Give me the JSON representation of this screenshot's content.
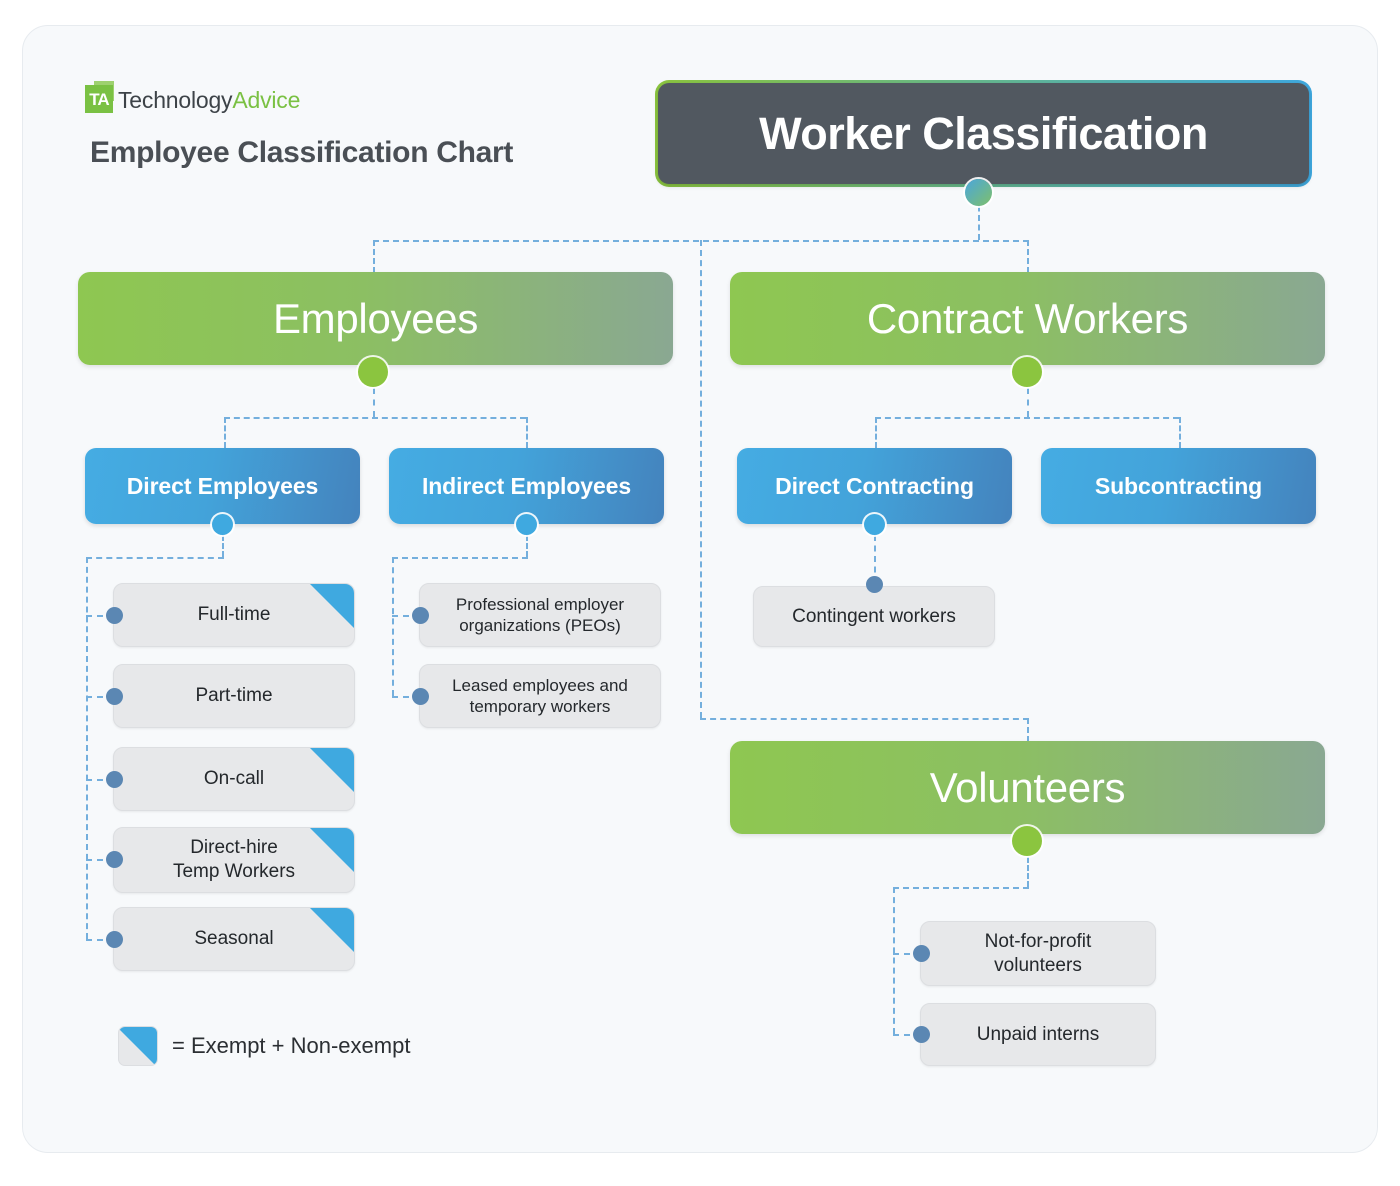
{
  "brand": {
    "logo_mark": "TA",
    "name_part1": "Technology",
    "name_part2": "Advice"
  },
  "page_title": "Employee Classification Chart",
  "legend": {
    "symbol": "blue-corner-triangle",
    "text": "= Exempt + Non-exempt"
  },
  "colors": {
    "green": "#8bc53f",
    "blue": "#3fa9e0",
    "dark": "#515860",
    "leaf_gray": "#e7e8ea",
    "connector": "#74afdd",
    "card_bg": "#f7f9fb"
  },
  "chart_data": {
    "type": "diagram",
    "title": "Worker Classification",
    "root": "Worker Classification",
    "nodes": {
      "root": {
        "label": "Worker Classification",
        "level": 0
      },
      "employees": {
        "label": "Employees",
        "level": 1
      },
      "contract_workers": {
        "label": "Contract Workers",
        "level": 1
      },
      "volunteers": {
        "label": "Volunteers",
        "level": 1
      },
      "direct_employees": {
        "label": "Direct Employees",
        "level": 2
      },
      "indirect_employees": {
        "label": "Indirect Employees",
        "level": 2
      },
      "direct_contracting": {
        "label": "Direct Contracting",
        "level": 2
      },
      "subcontracting": {
        "label": "Subcontracting",
        "level": 2
      }
    },
    "leaves": {
      "direct_employees": [
        {
          "label": "Full-time",
          "exempt_marker": true
        },
        {
          "label": "Part-time",
          "exempt_marker": false
        },
        {
          "label": "On-call",
          "exempt_marker": true
        },
        {
          "label": "Direct-hire\nTemp Workers",
          "exempt_marker": true
        },
        {
          "label": "Seasonal",
          "exempt_marker": true
        }
      ],
      "indirect_employees": [
        {
          "label": "Professional employer\norganizations (PEOs)",
          "exempt_marker": false
        },
        {
          "label": "Leased employees and\ntemporary workers",
          "exempt_marker": false
        }
      ],
      "direct_contracting": [
        {
          "label": "Contingent workers",
          "exempt_marker": false
        }
      ],
      "subcontracting": [],
      "volunteers": [
        {
          "label": "Not-for-profit\nvolunteers",
          "exempt_marker": false
        },
        {
          "label": "Unpaid interns",
          "exempt_marker": false
        }
      ]
    },
    "edges": [
      [
        "root",
        "employees"
      ],
      [
        "root",
        "contract_workers"
      ],
      [
        "root",
        "volunteers"
      ],
      [
        "employees",
        "direct_employees"
      ],
      [
        "employees",
        "indirect_employees"
      ],
      [
        "contract_workers",
        "direct_contracting"
      ],
      [
        "contract_workers",
        "subcontracting"
      ],
      [
        "direct_employees",
        "Full-time"
      ],
      [
        "direct_employees",
        "Part-time"
      ],
      [
        "direct_employees",
        "On-call"
      ],
      [
        "direct_employees",
        "Direct-hire Temp Workers"
      ],
      [
        "direct_employees",
        "Seasonal"
      ],
      [
        "indirect_employees",
        "Professional employer organizations (PEOs)"
      ],
      [
        "indirect_employees",
        "Leased employees and temporary workers"
      ],
      [
        "direct_contracting",
        "Contingent workers"
      ],
      [
        "volunteers",
        "Not-for-profit volunteers"
      ],
      [
        "volunteers",
        "Unpaid interns"
      ]
    ]
  },
  "labels": {
    "root": "Worker Classification",
    "employees": "Employees",
    "contract_workers": "Contract Workers",
    "volunteers": "Volunteers",
    "direct_employees": "Direct Employees",
    "indirect_employees": "Indirect Employees",
    "direct_contracting": "Direct Contracting",
    "subcontracting": "Subcontracting",
    "full_time": "Full-time",
    "part_time": "Part-time",
    "on_call": "On-call",
    "direct_hire_line1": "Direct-hire",
    "direct_hire_line2": "Temp Workers",
    "seasonal": "Seasonal",
    "peo_line1": "Professional employer",
    "peo_line2": "organizations (PEOs)",
    "leased_line1": "Leased employees and",
    "leased_line2": "temporary workers",
    "contingent_workers": "Contingent workers",
    "nfp_line1": "Not-for-profit",
    "nfp_line2": "volunteers",
    "unpaid_interns": "Unpaid interns"
  }
}
